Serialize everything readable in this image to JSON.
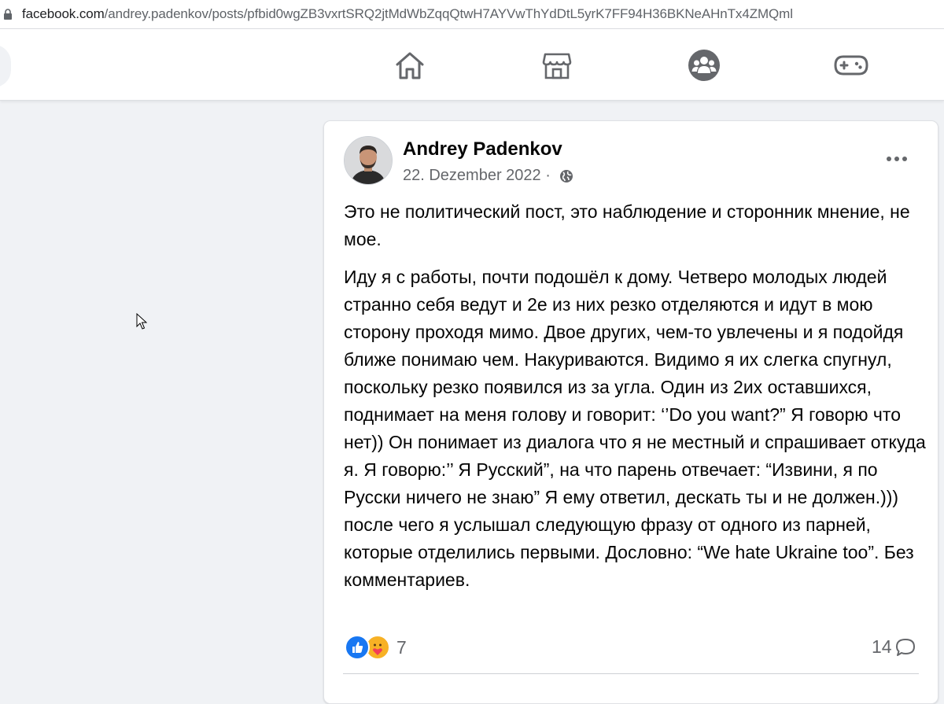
{
  "browser": {
    "url_host": "facebook.com",
    "url_path": "/andrey.padenkov/posts/pfbid0wgZB3vxrtSRQ2jtMdWbZqqQtwH7AYVwThYdDtL5yrK7FF94H36BKNeAHnTx4ZMQml"
  },
  "nav": {
    "icons": [
      "home-icon",
      "marketplace-icon",
      "groups-icon",
      "gaming-icon"
    ]
  },
  "post": {
    "author": "Andrey Padenkov",
    "date": "22. Dezember 2022",
    "separator": " · ",
    "paragraph_1": "Это не политический пост, это наблюдение и сторонник мнение, не мое.",
    "paragraph_2": "Иду я с работы, почти подошёл к дому. Четверо молодых людей странно себя ведут и 2е из них резко отделяются и идут в мою сторону проходя мимо. Двое других, чем-то увлечены и я подойдя ближе понимаю чем. Накуриваются. Видимо я их слегка спугнул, поскольку резко появился из за угла. Один из 2их оставшихся, поднимает на меня голову и говорит: ‘’Do you want?” Я говорю что нет)) Он понимает из диалога что я не местный и спрашивает откуда я. Я говорю:’’ Я Русский”, на что парень отвечает: “Извини, я по Русски ничего не знаю” Я ему ответил, дескать ты и не должен.))) после чего я услышал следующую фразу от одного из парней, которые отделились первыми. Дословно: “We hate Ukraine too”.  Без комментариев.",
    "reaction_count": "7",
    "comment_count": "14",
    "colors": {
      "like": "#1877f2",
      "care": "#f7b125",
      "text": "#050505",
      "meta": "#65676b"
    }
  }
}
